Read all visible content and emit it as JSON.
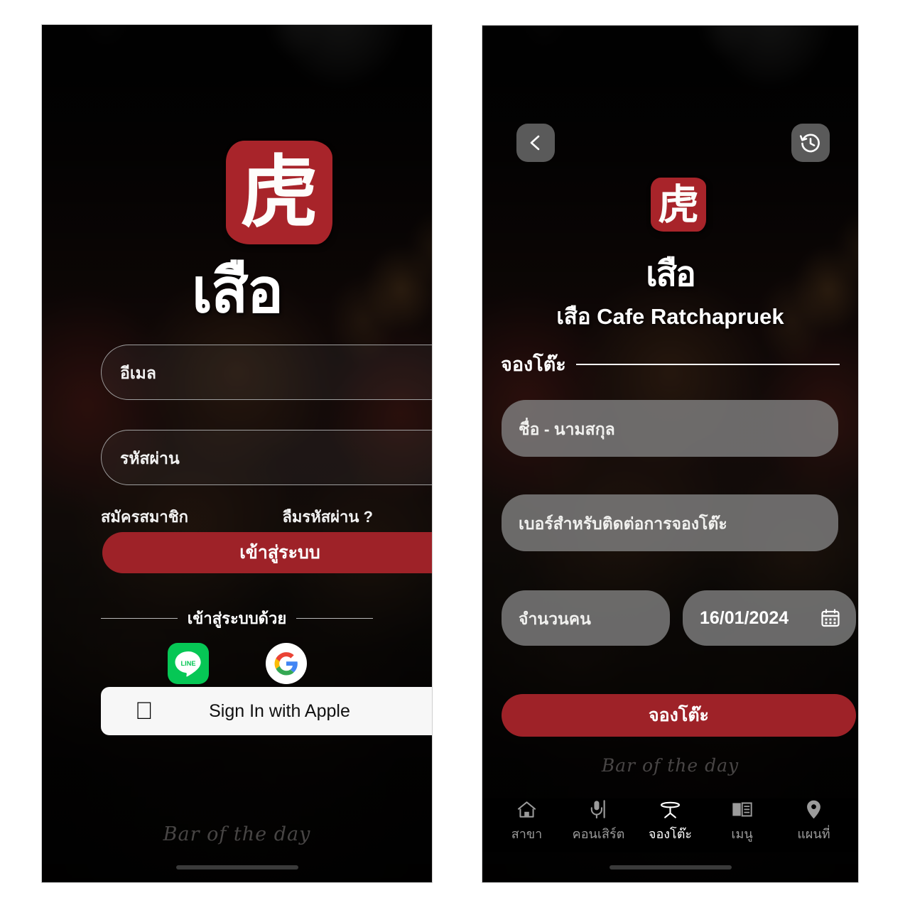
{
  "colors": {
    "brand_red": "#A8242A",
    "button_red": "#9E2228",
    "line_green": "#06C755",
    "screen_black": "#0A0908",
    "field_grey": "#828282"
  },
  "login_screen": {
    "logo_stamp_char": "虎",
    "wordmark": "เสือ",
    "email": {
      "placeholder": "อีเมล",
      "value": ""
    },
    "password": {
      "placeholder": "รหัสผ่าน",
      "value": ""
    },
    "register_link": "สมัครสมาชิก",
    "forgot_password_link": "ลืมรหัสผ่าน ?",
    "submit_label": "เข้าสู่ระบบ",
    "social_divider_label": "เข้าสู่ระบบด้วย",
    "line_icon_label": "LINE",
    "line_icon_name": "line-icon",
    "google_icon_name": "google-icon",
    "apple_icon_name": "apple-logo-icon",
    "apple_button_label": "Sign In with Apple",
    "watermark": "Bar of the day"
  },
  "booking_screen": {
    "back_icon_name": "chevron-left-icon",
    "history_icon_name": "history-clock-icon",
    "logo_stamp_char": "虎",
    "wordmark": "เสือ",
    "cafe_name": "เสือ Cafe Ratchapruek",
    "section_header": "จองโต๊ะ",
    "name_field": {
      "placeholder": "ชื่อ - นามสกุล",
      "value": ""
    },
    "phone_field": {
      "placeholder": "เบอร์สำหรับติดต่อการจองโต๊ะ",
      "value": ""
    },
    "people_field": {
      "placeholder": "จำนวนคน",
      "value": ""
    },
    "date_field": {
      "value": "16/01/2024",
      "icon_name": "calendar-icon"
    },
    "submit_label": "จองโต๊ะ",
    "watermark": "Bar of the day",
    "nav_items": [
      {
        "label": "สาขา",
        "icon": "home-icon",
        "active": false
      },
      {
        "label": "คอนเสิร์ต",
        "icon": "microphone-icon",
        "active": false
      },
      {
        "label": "จองโต๊ะ",
        "icon": "table-icon",
        "active": true
      },
      {
        "label": "เมนู",
        "icon": "book-icon",
        "active": false
      },
      {
        "label": "แผนที่",
        "icon": "map-pin-icon",
        "active": false
      }
    ]
  }
}
